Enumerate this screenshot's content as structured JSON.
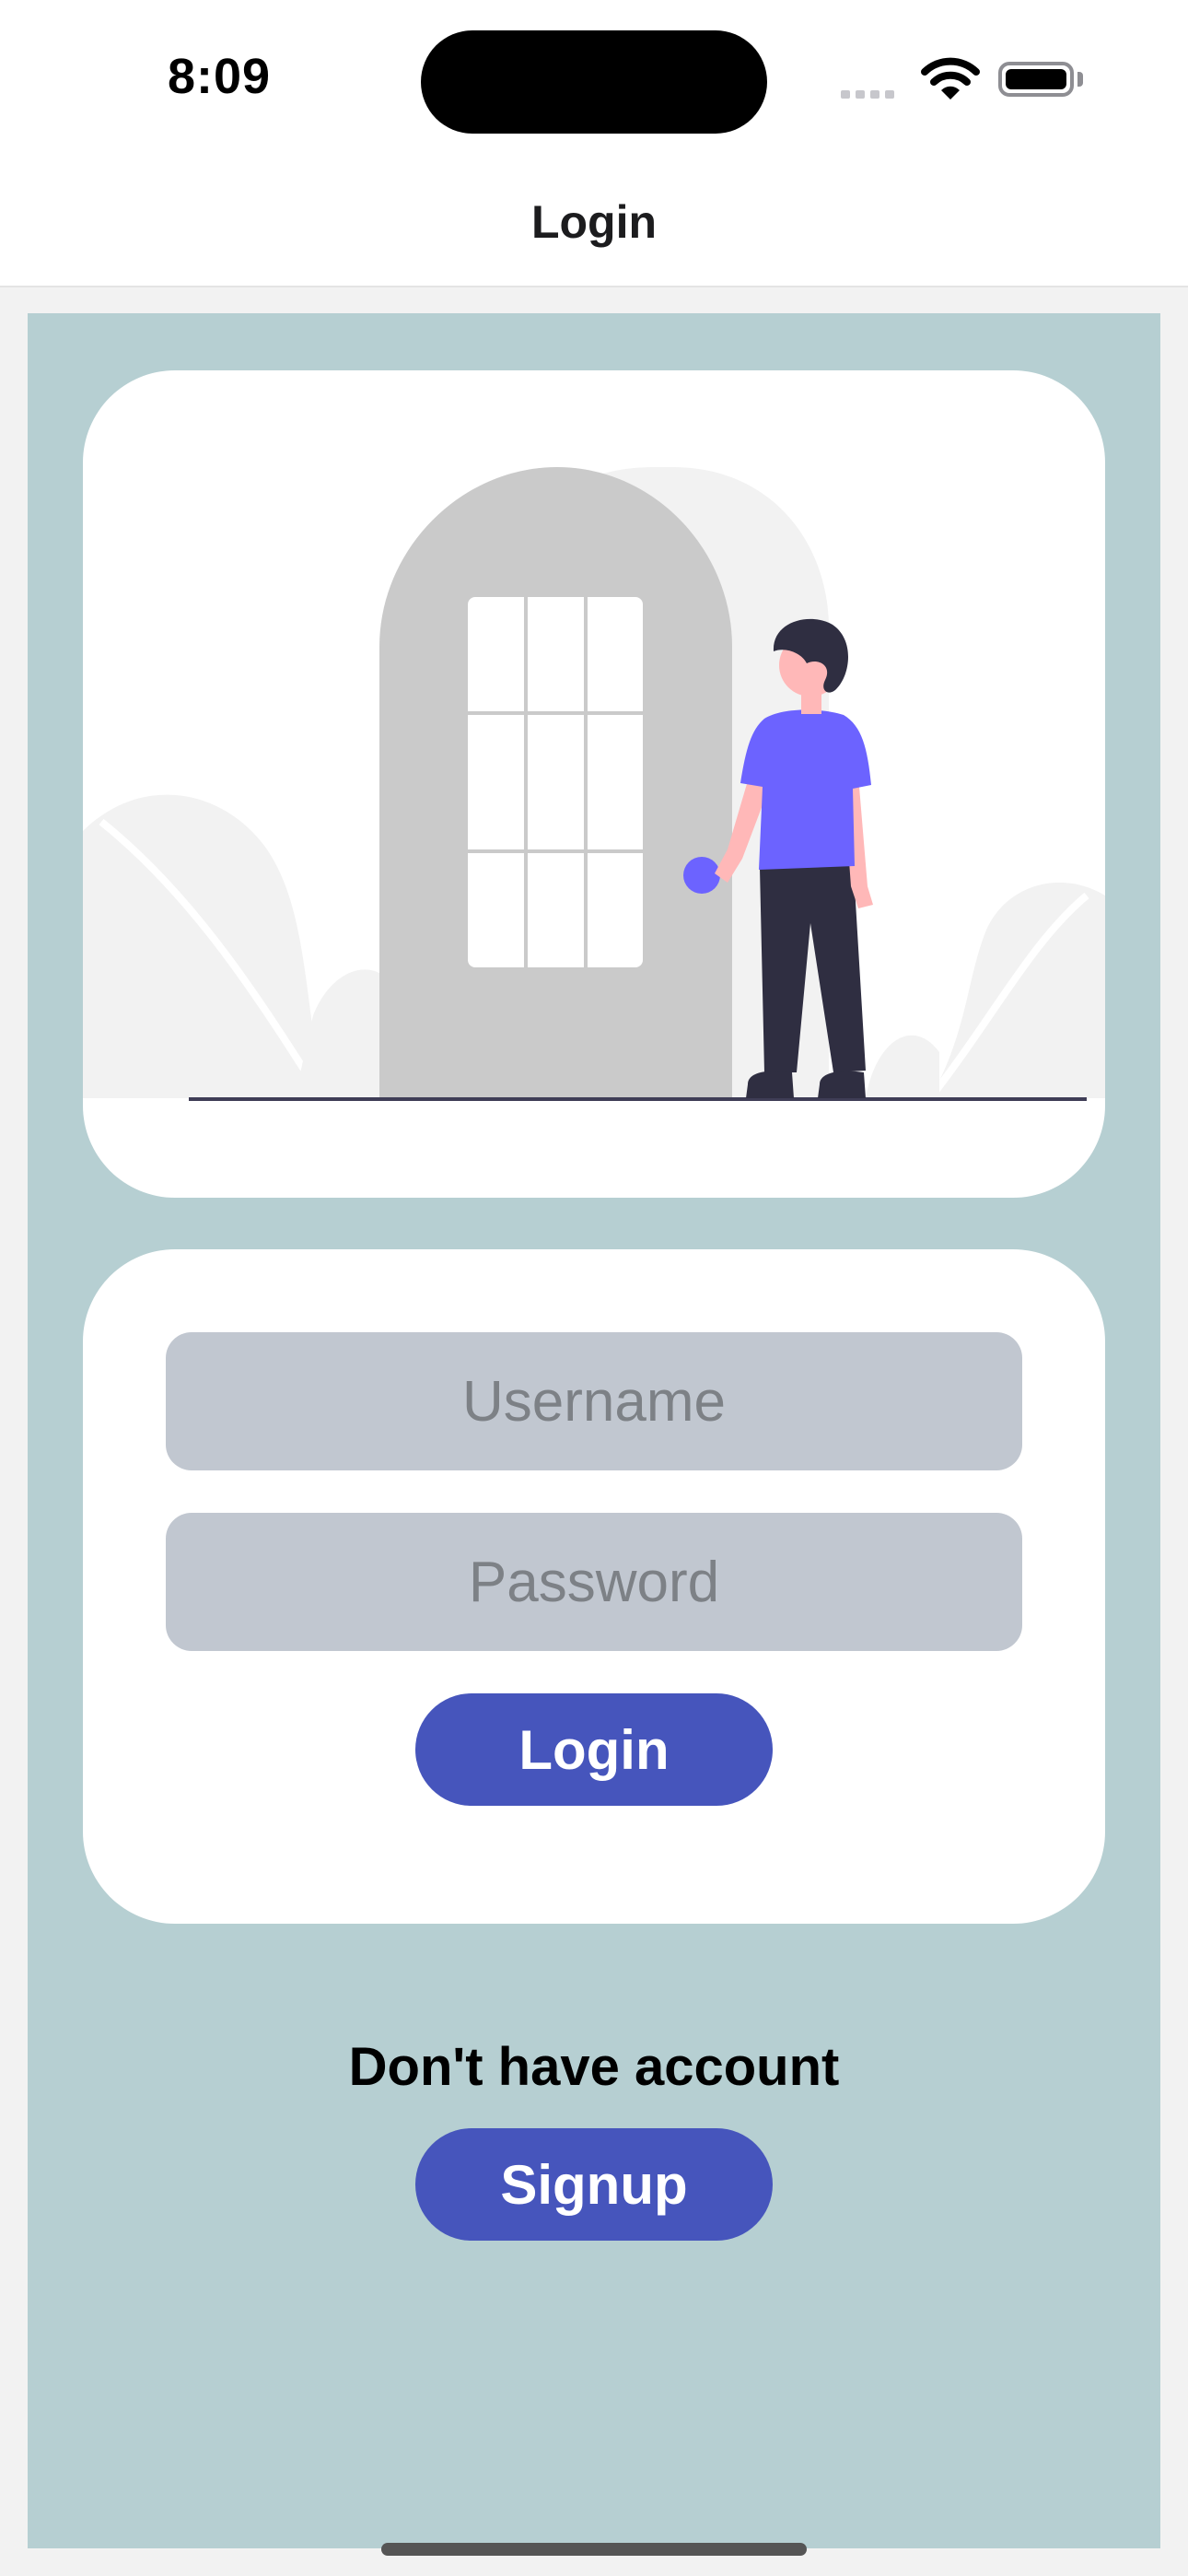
{
  "status_bar": {
    "time": "8:09",
    "icons": [
      "cellular-signal-icon",
      "wifi-icon",
      "battery-icon"
    ]
  },
  "nav": {
    "title": "Login"
  },
  "illustration": {
    "icon": "person-at-door-illustration"
  },
  "form": {
    "username_placeholder": "Username",
    "password_placeholder": "Password",
    "login_label": "Login"
  },
  "signup": {
    "prompt": "Don't have account",
    "button_label": "Signup"
  },
  "colors": {
    "background": "#b6cfd2",
    "card": "#ffffff",
    "field": "#c1c7d0",
    "button": "#4655bc",
    "accent_figure": "#6c63ff"
  }
}
